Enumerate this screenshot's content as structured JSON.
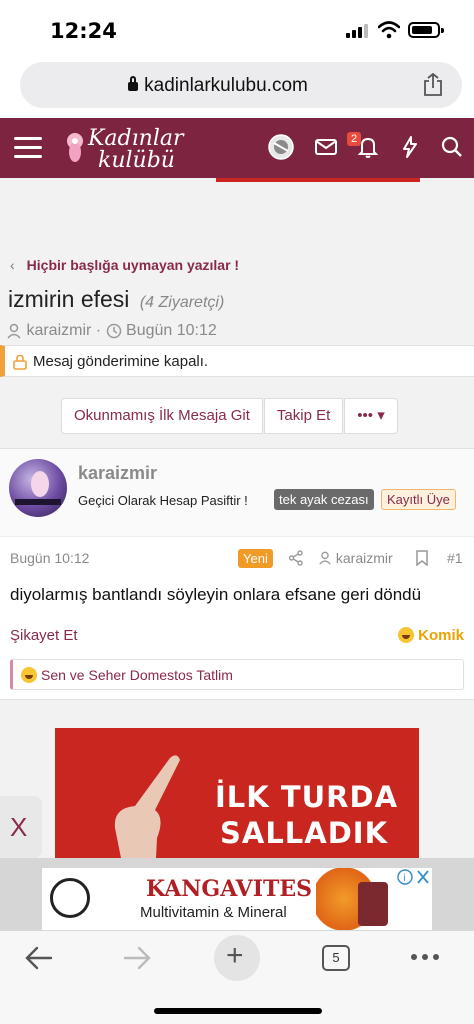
{
  "status": {
    "time": "12:24"
  },
  "browser": {
    "url": "kadinlarkulubu.com",
    "tab_count": "5"
  },
  "header": {
    "logo_line1": "Kadınlar",
    "logo_line2": "kulübü",
    "notification_count": "2"
  },
  "breadcrumb": {
    "label": "Hiçbir başlığa uymayan yazılar !"
  },
  "thread": {
    "title": "izmirin efesi",
    "visits": "(4 Ziyaretçi)",
    "author": "karaizmir",
    "date": "Bugün 10:12",
    "closed_notice": "Mesaj gönderimine kapalı."
  },
  "actions": {
    "first_unread": "Okunmamış İlk Mesaja Git",
    "follow": "Takip Et",
    "more": "•••"
  },
  "post": {
    "username": "karaizmir",
    "user_title": "Geçici Olarak Hesap Pasiftir !",
    "tag_penalty": "tek ayak cezası",
    "tag_member": "Kayıtlı Üye",
    "date": "Bugün 10:12",
    "new_label": "Yeni",
    "author": "karaizmir",
    "number": "#1",
    "body": "diyolarmış bantlandı söyleyin onlara efsane geri döndü",
    "report": "Şikayet Et",
    "reaction": "Komik",
    "reactions_summary": "Sen ve Seher Domestos Tatlim"
  },
  "ads": {
    "banner_line1": "İLK TURDA",
    "banner_line2": "SALLADIK",
    "close_label": "X",
    "bottom_brand": "KANGAVITES",
    "bottom_sub": "Multivitamin & Mineral"
  },
  "colors": {
    "brand": "#7d2540",
    "accent": "#8a2a4a",
    "new": "#f09a28"
  }
}
